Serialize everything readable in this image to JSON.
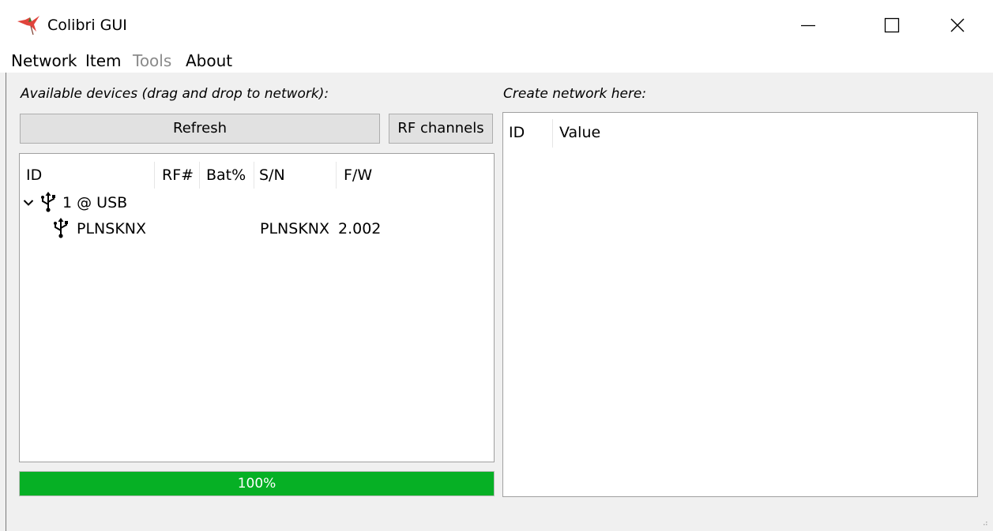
{
  "window": {
    "title": "Colibri GUI",
    "controls": {
      "minimize": "minimize",
      "maximize": "maximize",
      "close": "close"
    }
  },
  "menu": [
    {
      "label": "Network",
      "enabled": true
    },
    {
      "label": "Item",
      "enabled": true
    },
    {
      "label": "Tools",
      "enabled": false
    },
    {
      "label": "About",
      "enabled": true
    }
  ],
  "left_panel": {
    "label": "Available devices (drag and drop to network):",
    "refresh_label": "Refresh",
    "rf_channels_label": "RF channels",
    "columns": [
      "ID",
      "RF#",
      "Bat%",
      "S/N",
      "F/W"
    ],
    "rows": [
      {
        "id": "1 @ USB",
        "rf": "",
        "bat": "",
        "sn": "",
        "fw": "",
        "expanded": true,
        "icon": "usb-icon",
        "level": 0
      },
      {
        "id": "PLNSKNX",
        "rf": "",
        "bat": "",
        "sn": "PLNSKNX",
        "fw": "2.002",
        "icon": "usb-icon",
        "level": 1
      }
    ],
    "progress": {
      "value": 100,
      "text": "100%"
    }
  },
  "right_panel": {
    "label": "Create network here:",
    "columns": [
      "ID",
      "Value"
    ]
  },
  "colors": {
    "progress_fill": "#06b025",
    "button_bg": "#e1e1e1",
    "disabled_text": "#8a8a8a",
    "window_bg": "#f0f0f0"
  }
}
